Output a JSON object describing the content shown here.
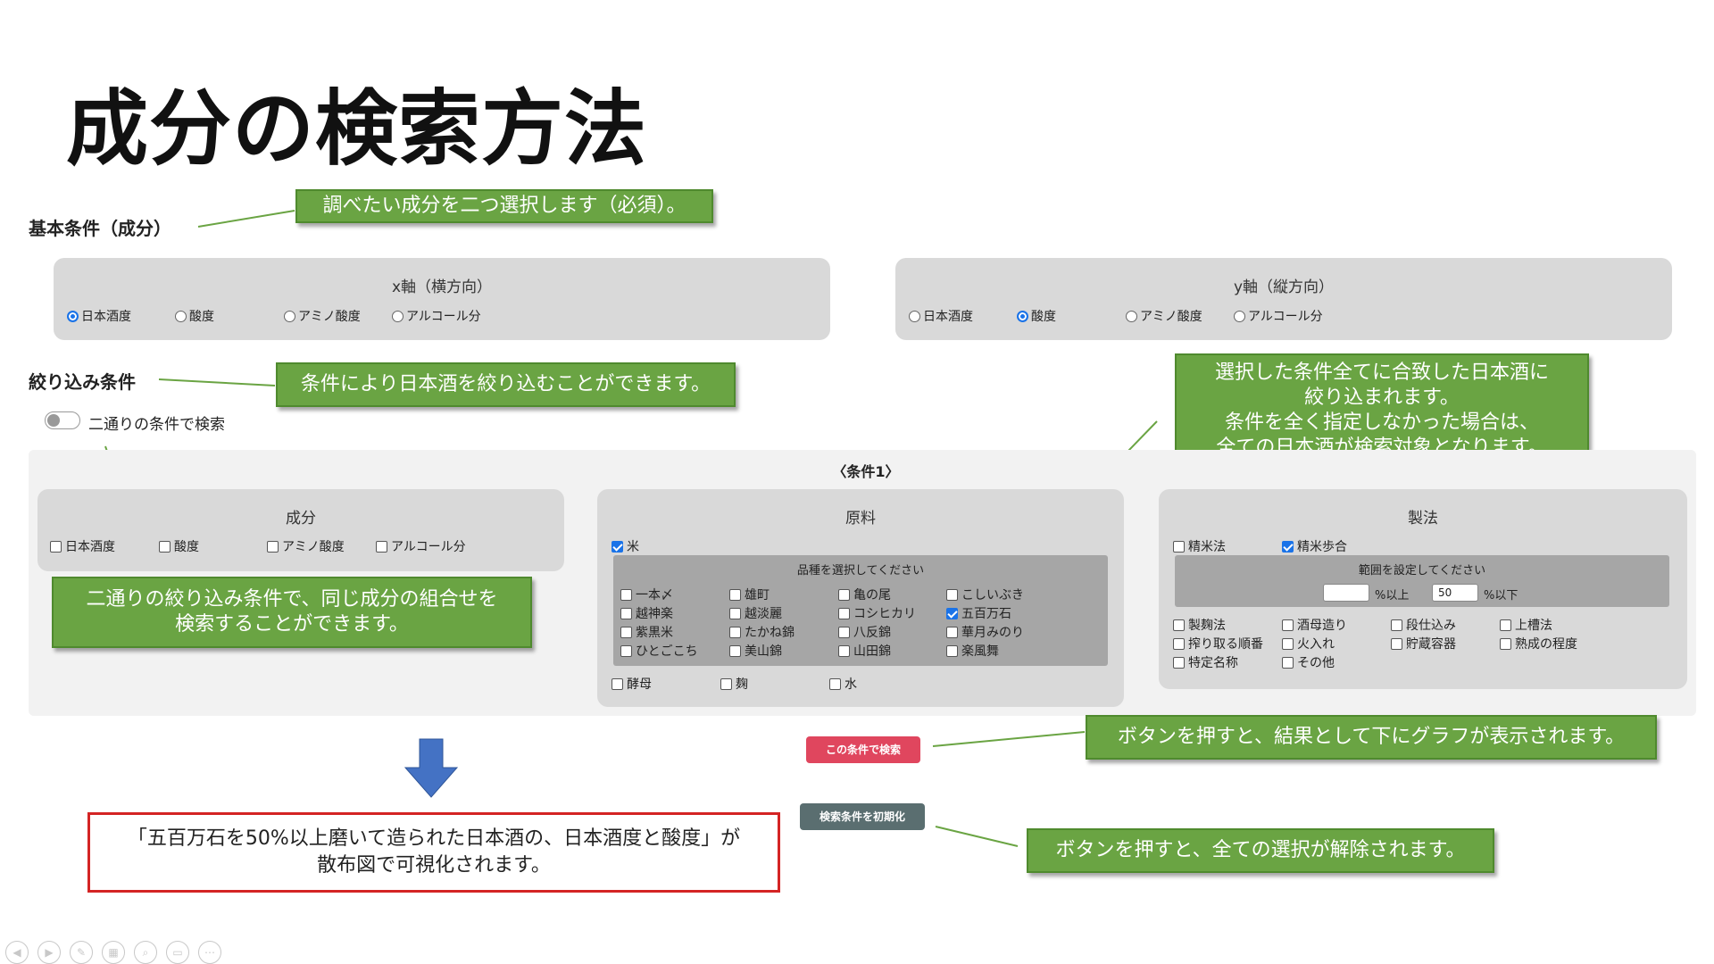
{
  "slide_title": "成分の検索方法",
  "basic_section": "基本条件（成分）",
  "callout_basic": "調べたい成分を二つ選択します（必須）。",
  "x_axis": {
    "title": "x軸（横方向）",
    "options": [
      "日本酒度",
      "酸度",
      "アミノ酸度",
      "アルコール分"
    ],
    "selected": "日本酒度"
  },
  "y_axis": {
    "title": "y軸（縦方向）",
    "options": [
      "日本酒度",
      "酸度",
      "アミノ酸度",
      "アルコール分"
    ],
    "selected": "酸度"
  },
  "filter_section": "絞り込み条件",
  "callout_filter": "条件により日本酒を絞り込むことができます。",
  "callout_all": [
    "選択した条件全てに合致した日本酒に",
    "絞り込まれます。",
    "条件を全く指定しなかった場合は、",
    "全ての日本酒が検索対象となります。"
  ],
  "toggle_label": "二通りの条件で検索",
  "toggle_on": false,
  "condition_label": "〈条件1〉",
  "component_panel": {
    "title": "成分",
    "items": [
      "日本酒度",
      "酸度",
      "アミノ酸度",
      "アルコール分"
    ]
  },
  "callout_twoway": [
    "二通りの絞り込み条件で、同じ成分の組合せを",
    "検索することができます。"
  ],
  "ingredient_panel": {
    "title": "原料",
    "rice_label": "米",
    "rice_checked": true,
    "variety_title": "品種を選択してください",
    "varieties": [
      "一本〆",
      "雄町",
      "亀の尾",
      "こしいぶき",
      "越神楽",
      "越淡麗",
      "コシヒカリ",
      "五百万石",
      "紫黒米",
      "たかね錦",
      "八反錦",
      "華月みのり",
      "ひとごこち",
      "美山錦",
      "山田錦",
      "楽風舞"
    ],
    "checked_variety": "五百万石",
    "others": [
      "酵母",
      "麹",
      "水"
    ]
  },
  "method_panel": {
    "title": "製法",
    "top_items": [
      "精米法",
      "精米歩合"
    ],
    "checked": "精米歩合",
    "range_title": "範囲を設定してください",
    "min_value": "",
    "min_suffix": "%以上",
    "max_value": "50",
    "max_suffix": "%以下",
    "items": [
      "製麹法",
      "酒母造り",
      "段仕込み",
      "上槽法",
      "搾り取る順番",
      "火入れ",
      "貯蔵容器",
      "熟成の程度",
      "特定名称",
      "その他"
    ]
  },
  "search_button": "この条件で検索",
  "reset_button": "検索条件を初期化",
  "callout_search": "ボタンを押すと、結果として下にグラフが表示されます。",
  "callout_reset": "ボタンを押すと、全ての選択が解除されます。",
  "result_note": [
    "「五百万石を50%以上磨いて造られた日本酒の、日本酒度と酸度」が",
    "散布図で可視化されます。"
  ],
  "colors": {
    "callout_green": "#6aa443",
    "panel_gray": "#d9d9d9",
    "search_red": "#e0465e",
    "reset_slate": "#5a6e70",
    "arrow_blue": "#4472c4",
    "note_border": "#d42424"
  }
}
